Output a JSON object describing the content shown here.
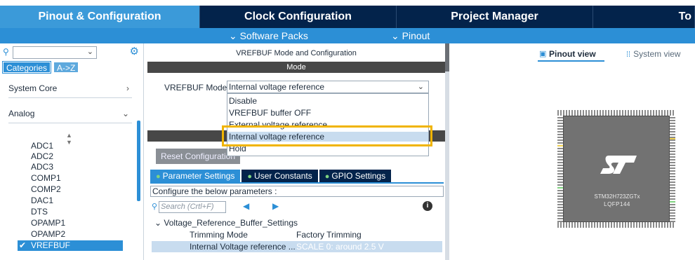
{
  "top_tabs": [
    {
      "label": "Pinout & Configuration"
    },
    {
      "label": "Clock Configuration"
    },
    {
      "label": "Project Manager"
    },
    {
      "label": "To"
    }
  ],
  "sub_menu": {
    "software_packs": "Software Packs",
    "pinout": "Pinout"
  },
  "left_panel": {
    "category_tabs": [
      "Categories",
      "A->Z"
    ],
    "categories": [
      {
        "label": "System Core",
        "arrow": "›"
      },
      {
        "label": "Analog",
        "arrow": "⌄"
      }
    ],
    "peripherals": [
      "ADC1",
      "ADC2",
      "ADC3",
      "COMP1",
      "COMP2",
      "DAC1",
      "DTS",
      "OPAMP1",
      "OPAMP2"
    ],
    "selected_peripheral": "VREFBUF"
  },
  "middle_panel": {
    "title": "VREFBUF Mode and Configuration",
    "mode_header": "Mode",
    "mode_label": "VREFBUF Mode",
    "mode_value": "Internal voltage reference",
    "mode_options": [
      "Disable",
      "VREFBUF buffer OFF",
      "External voltage reference",
      "Internal voltage reference",
      "Hold"
    ],
    "reset_button": "Reset Configuration",
    "param_tabs": [
      "Parameter Settings",
      "User Constants",
      "GPIO Settings"
    ],
    "configure_text": "Configure the below parameters :",
    "search_placeholder": "Search (Crtl+F)",
    "group_label": "Voltage_Reference_Buffer_Settings",
    "params": [
      {
        "name": "Trimming Mode",
        "value": "Factory Trimming"
      },
      {
        "name": "Internal Voltage reference ...",
        "value": "SCALE 0: around 2.5 V"
      }
    ]
  },
  "right_panel": {
    "view_tabs": [
      "Pinout view",
      "System view"
    ],
    "chip_name": "STM32H723ZGTx",
    "chip_package": "LQFP144"
  }
}
